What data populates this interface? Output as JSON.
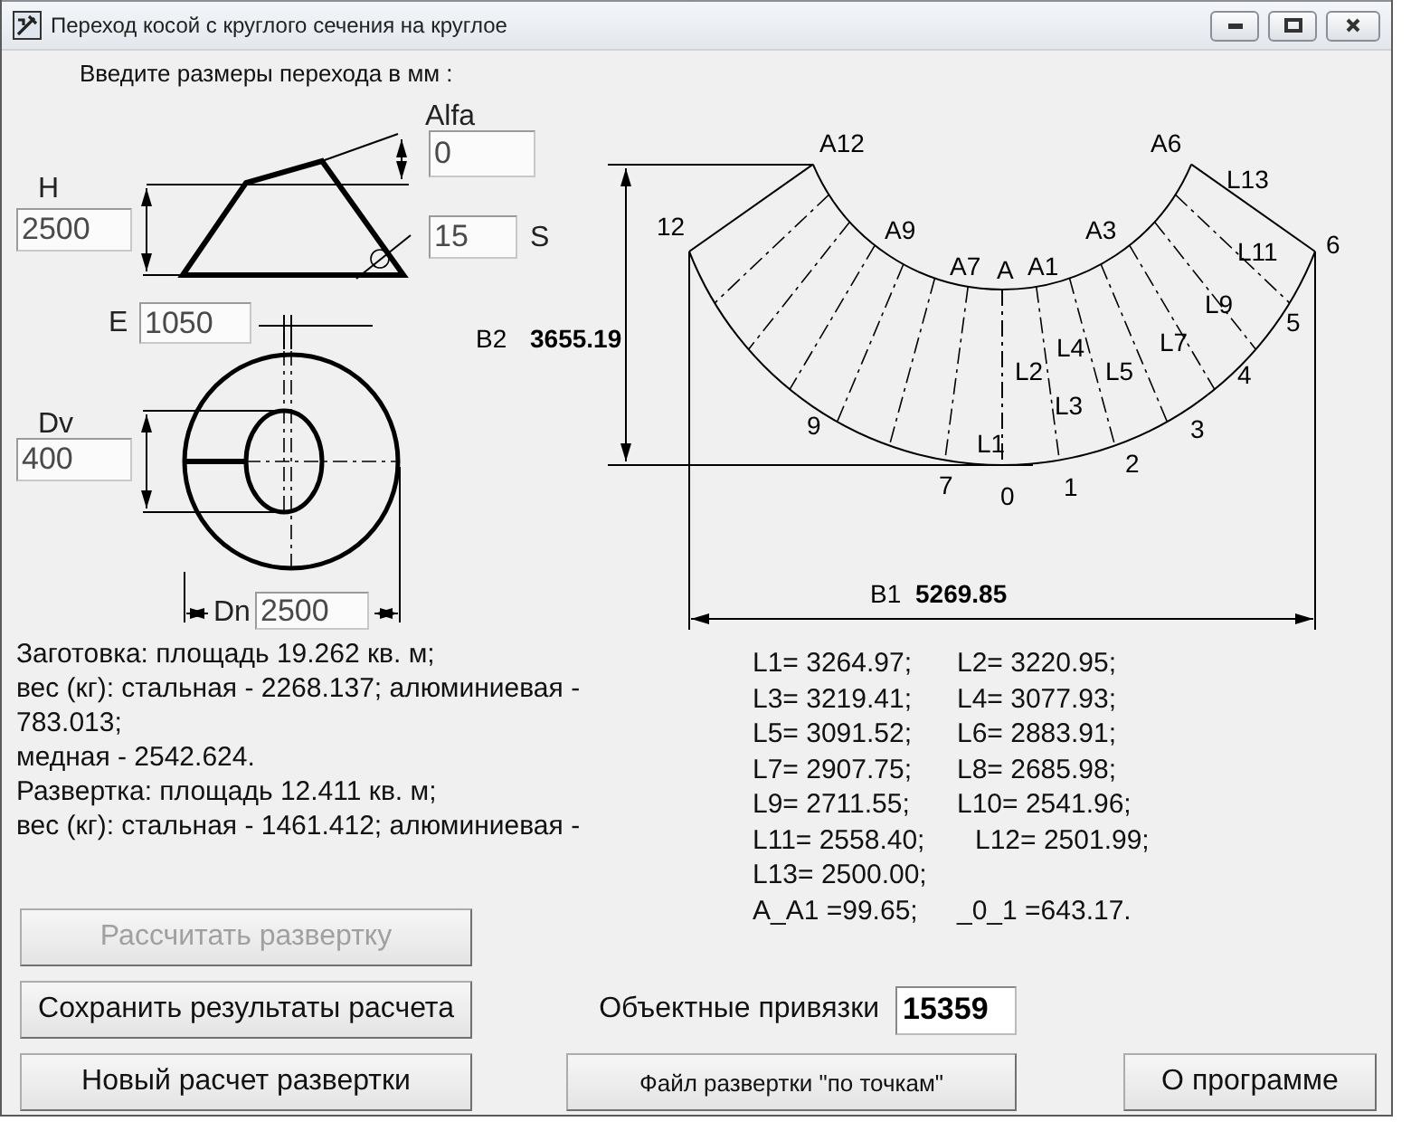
{
  "window": {
    "title": "Переход косой с круглого сечения на круглое"
  },
  "prompt": "Введите размеры перехода в мм :",
  "inputs": [
    {
      "label": "Alfa",
      "value": "0"
    },
    {
      "label": "H",
      "value": "2500"
    },
    {
      "label": "S",
      "value": "15"
    },
    {
      "label": "E",
      "value": "1050"
    },
    {
      "label": "Dv",
      "value": "400"
    },
    {
      "label": "Dn",
      "value": "2500"
    }
  ],
  "development": {
    "labels": [
      "A12",
      "A6",
      "L13",
      "12",
      "A9",
      "A3",
      "6",
      "A7",
      "A",
      "A1",
      "L11",
      "L9",
      "5",
      "L4",
      "L7",
      "L2",
      "L5",
      "4",
      "L3",
      "9",
      "3",
      "L1",
      "2",
      "7",
      "0",
      "1"
    ],
    "b2": {
      "label": "B2",
      "value": "3655.19"
    },
    "b1": {
      "label": "B1",
      "value": "5269.85"
    }
  },
  "summary_lines": [
    "Заготовка: площадь 19.262 кв. м;",
    "вес (кг): стальная - 2268.137; алюминиевая -",
    "783.013;",
    "медная - 2542.624.",
    "Развертка: площадь 12.411 кв. м;",
    "вес (кг): стальная - 1461.412; алюминиевая -"
  ],
  "lengths": [
    [
      "L1= 3264.97;",
      "L2= 3220.95;"
    ],
    [
      "L3= 3219.41;",
      "L4= 3077.93;"
    ],
    [
      "L5= 3091.52;",
      "L6= 2883.91;"
    ],
    [
      "L7= 2907.75;",
      "L8= 2685.98;"
    ],
    [
      "L9= 2711.55;",
      "L10= 2541.96;"
    ],
    [
      "L11= 2558.40;",
      "L12= 2501.99;"
    ],
    [
      "L13= 2500.00;"
    ],
    [
      "A_A1 =99.65;",
      "_0_1 =643.17."
    ]
  ],
  "buttons": [
    {
      "label": "Рассчитать развертку",
      "disabled": true
    },
    {
      "label": "Сохранить результаты расчета",
      "disabled": false
    },
    {
      "label": "Новый расчет развертки",
      "disabled": false
    }
  ],
  "snaps": {
    "label": "Объектные привязки",
    "value": "15359"
  },
  "file_button": {
    "label": "Файл развертки \"по точкам\""
  },
  "about_button": {
    "label": "О программе"
  }
}
